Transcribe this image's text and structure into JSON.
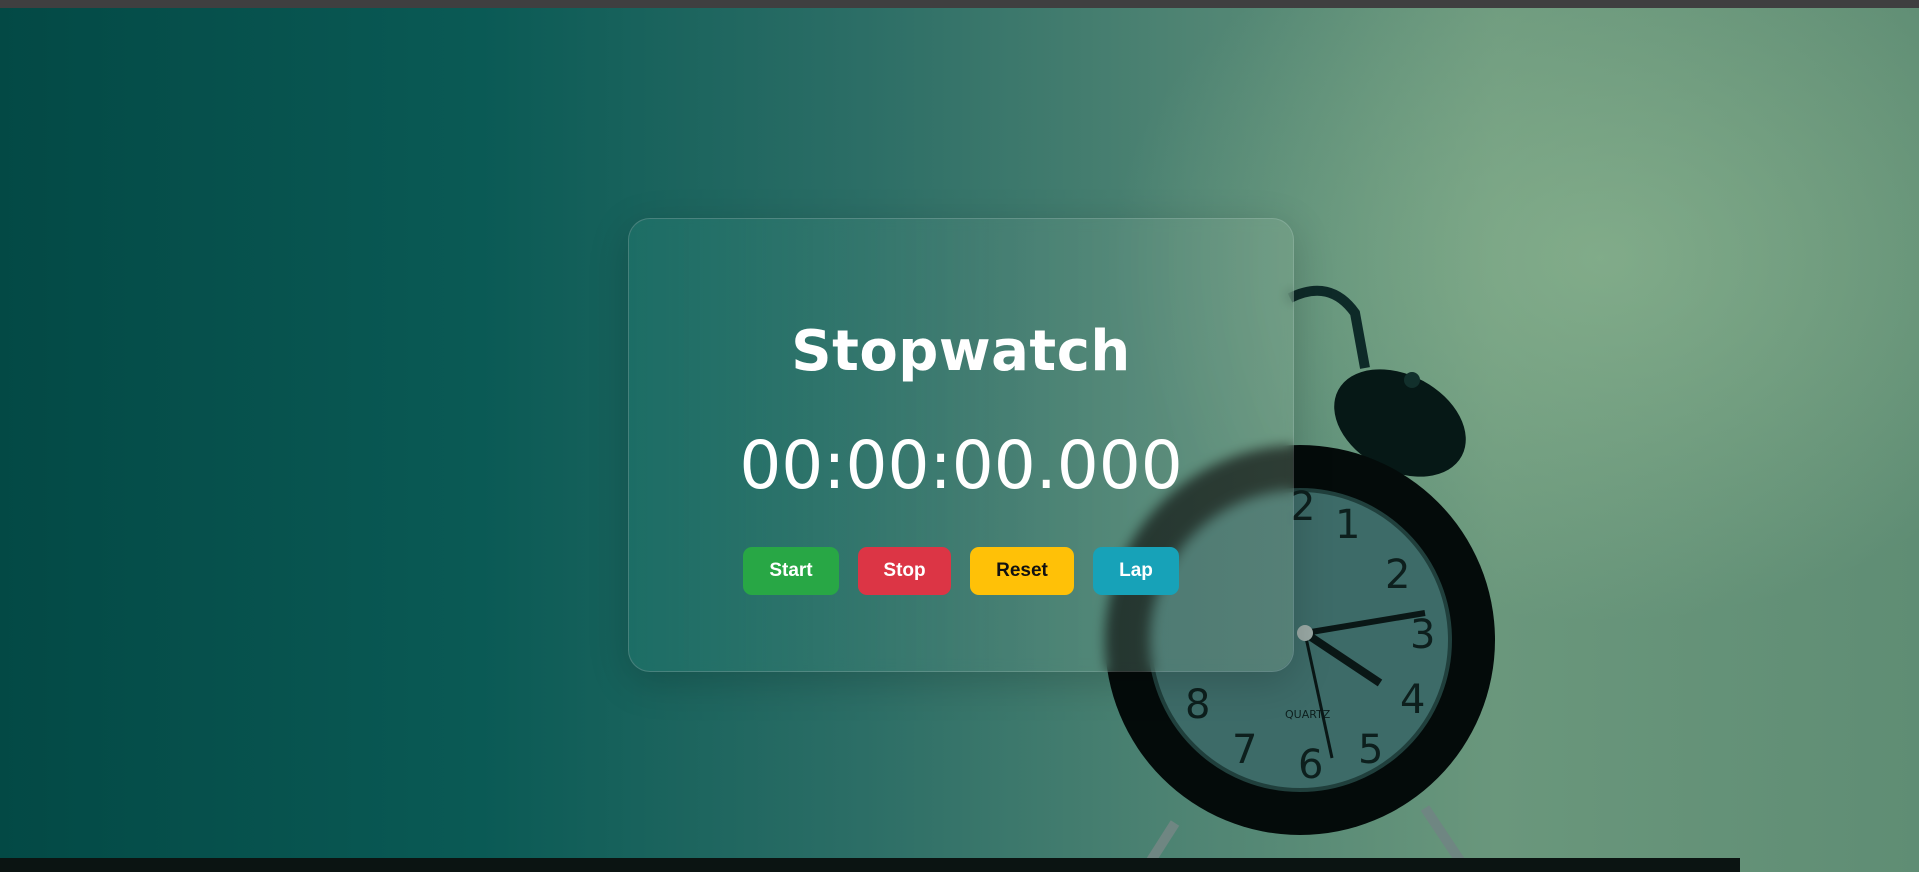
{
  "app": {
    "title": "Stopwatch",
    "time_display": "00:00:00.000"
  },
  "controls": {
    "start_label": "Start",
    "stop_label": "Stop",
    "reset_label": "Reset",
    "lap_label": "Lap"
  },
  "colors": {
    "start": "#28a745",
    "stop": "#dc3545",
    "reset": "#ffc107",
    "lap": "#17a2b8",
    "background": "#0a5a55"
  },
  "background_image": {
    "icon": "alarm-clock-icon",
    "clock_face": {
      "numbers": [
        "1",
        "2",
        "3",
        "4",
        "5",
        "6",
        "7",
        "8",
        "2"
      ],
      "brand": "QUARTZ"
    }
  }
}
